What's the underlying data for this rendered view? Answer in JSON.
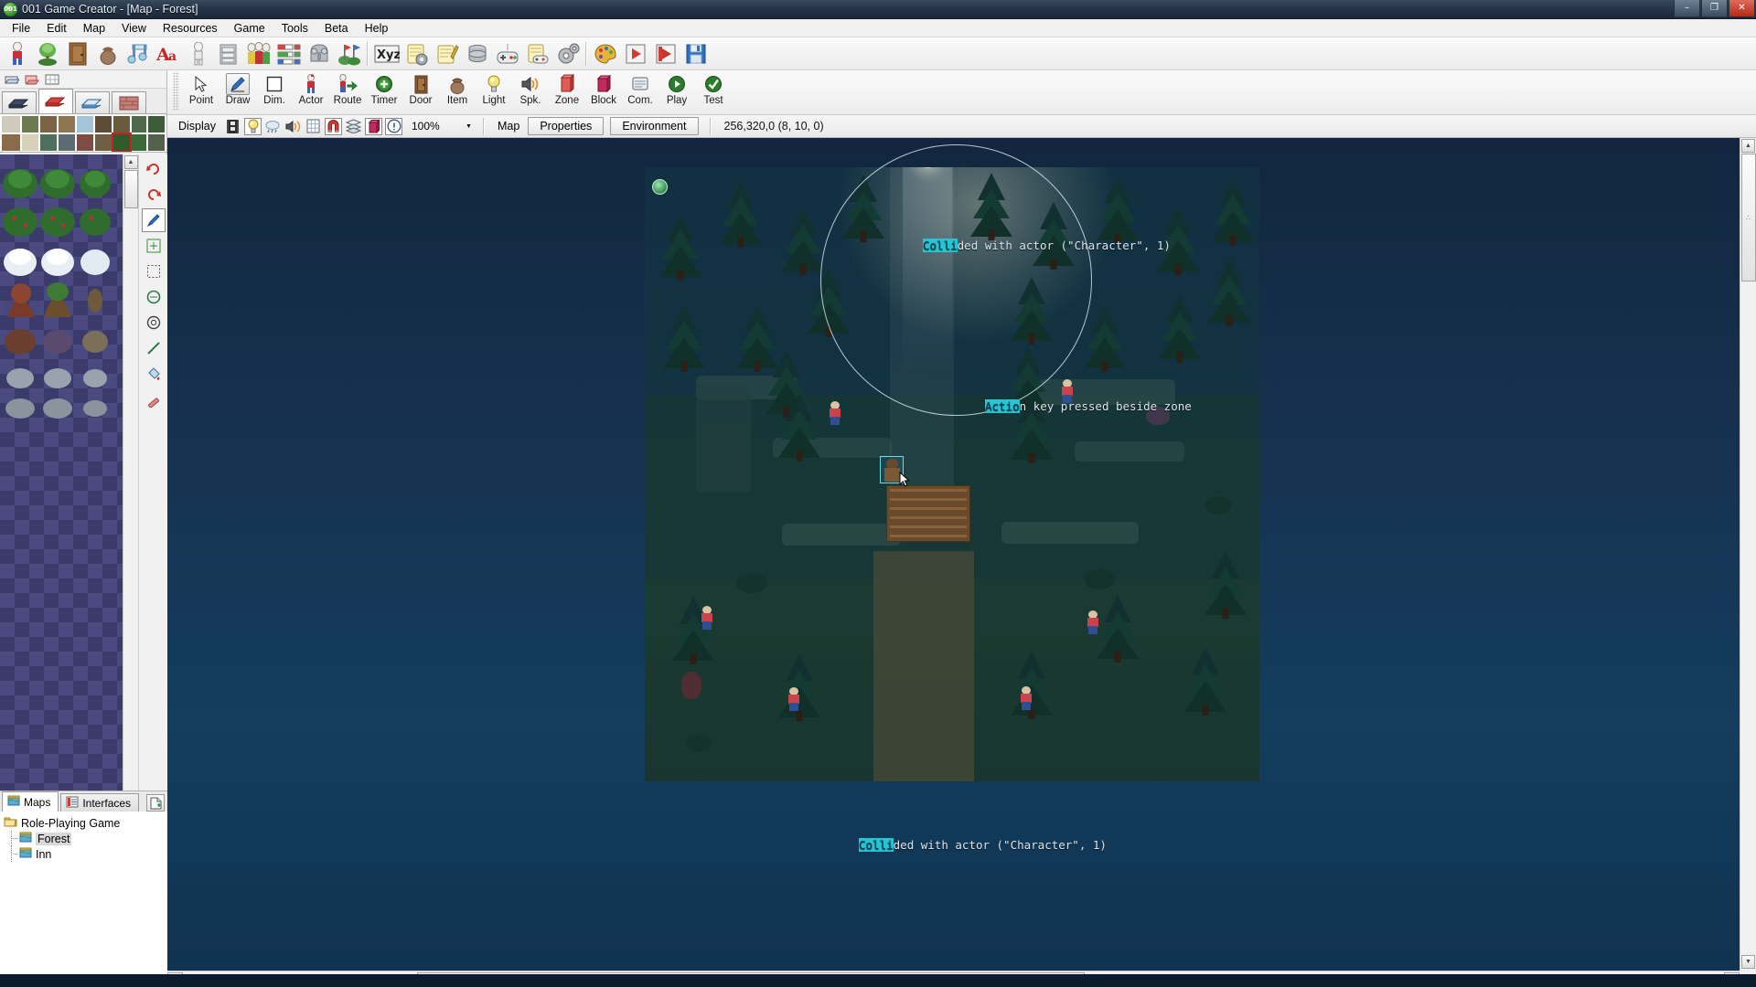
{
  "window": {
    "title": "001 Game Creator - [Map - Forest]",
    "app_icon": "001",
    "minimize": "–",
    "maximize": "❐",
    "close": "✕"
  },
  "menu": {
    "items": [
      {
        "label": "File"
      },
      {
        "label": "Edit"
      },
      {
        "label": "Map"
      },
      {
        "label": "View"
      },
      {
        "label": "Resources"
      },
      {
        "label": "Game"
      },
      {
        "label": "Tools"
      },
      {
        "label": "Beta"
      },
      {
        "label": "Help"
      }
    ]
  },
  "main_toolbar": {
    "buttons": [
      {
        "name": "actor-icon",
        "title": "Actors"
      },
      {
        "name": "tree-icon",
        "title": "Plants"
      },
      {
        "name": "door-icon",
        "title": "Doors"
      },
      {
        "name": "item-icon",
        "title": "Items"
      },
      {
        "name": "music-icon",
        "title": "Music"
      },
      {
        "name": "font-icon",
        "title": "Fonts"
      },
      {
        "name": "skeleton-icon",
        "title": "Animations"
      },
      {
        "name": "cabinet-icon",
        "title": "Database"
      },
      {
        "name": "party-icon",
        "title": "Party"
      },
      {
        "name": "bars-icon",
        "title": "Attributes"
      },
      {
        "name": "armor-icon",
        "title": "Armor"
      },
      {
        "name": "flags-icon",
        "title": "Teams"
      },
      {
        "name": "xyz-icon",
        "title": "Variables"
      },
      {
        "name": "script-gear-icon",
        "title": "Scripts"
      },
      {
        "name": "script-edit-icon",
        "title": "Edit script"
      },
      {
        "name": "database-icon",
        "title": "Data"
      },
      {
        "name": "gamepad-icon",
        "title": "Controls"
      },
      {
        "name": "script-gamepad-icon",
        "title": "Input scripts"
      },
      {
        "name": "gears-icon",
        "title": "Settings"
      },
      {
        "name": "palette-icon",
        "title": "Palette"
      },
      {
        "name": "play-icon",
        "title": "Play"
      },
      {
        "name": "record-icon",
        "title": "Record"
      },
      {
        "name": "save-icon",
        "title": "Save"
      }
    ]
  },
  "tools_toolbar": {
    "active": "Draw",
    "tools": [
      {
        "label": "Point",
        "icon": "cursor-icon"
      },
      {
        "label": "Draw",
        "icon": "pencil-icon"
      },
      {
        "label": "Dim.",
        "icon": "square-icon"
      },
      {
        "label": "Actor",
        "icon": "actor-icon"
      },
      {
        "label": "Route",
        "icon": "route-icon"
      },
      {
        "label": "Timer",
        "icon": "timer-icon"
      },
      {
        "label": "Door",
        "icon": "door-icon"
      },
      {
        "label": "Item",
        "icon": "item-bag-icon"
      },
      {
        "label": "Light",
        "icon": "lightbulb-icon"
      },
      {
        "label": "Spk.",
        "icon": "speaker-icon"
      },
      {
        "label": "Zone",
        "icon": "zone-icon"
      },
      {
        "label": "Block",
        "icon": "block-icon"
      },
      {
        "label": "Com.",
        "icon": "command-icon"
      },
      {
        "label": "Play",
        "icon": "play-icon"
      },
      {
        "label": "Test",
        "icon": "test-icon"
      }
    ]
  },
  "display_bar": {
    "label": "Display",
    "icons": [
      {
        "name": "film-icon",
        "active": false
      },
      {
        "name": "lightbulb-icon",
        "active": true
      },
      {
        "name": "weather-icon",
        "active": false
      },
      {
        "name": "sound-icon",
        "active": false
      },
      {
        "name": "grid-icon",
        "active": false
      },
      {
        "name": "magnet-icon",
        "active": true
      },
      {
        "name": "layers-icon",
        "active": false
      },
      {
        "name": "block-icon",
        "active": true
      },
      {
        "name": "info-icon",
        "active": true
      }
    ],
    "zoom": "100%",
    "dropdown_arrow": "▼",
    "map_label": "Map",
    "tabs": [
      {
        "label": "Properties"
      },
      {
        "label": "Environment"
      }
    ],
    "coordinates": "256,320,0 (8, 10, 0)"
  },
  "left_panel": {
    "mini_toolbar": [
      {
        "name": "tileset-open-icon"
      },
      {
        "name": "tileset-import-icon"
      },
      {
        "name": "tileset-grid-icon"
      }
    ],
    "tileset_tabs": [
      {
        "name": "tab-tileset-a",
        "active": false
      },
      {
        "name": "tab-tileset-b",
        "active": true
      },
      {
        "name": "tab-tileset-c",
        "active": false
      },
      {
        "name": "tab-tileset-wall",
        "active": false
      }
    ],
    "vertical_tools": [
      {
        "name": "undo-icon",
        "active": false
      },
      {
        "name": "redo-icon",
        "active": false
      },
      {
        "name": "pencil-tool-icon",
        "active": true
      },
      {
        "name": "fill-tool-icon",
        "active": false
      },
      {
        "name": "rect-select-icon",
        "active": false
      },
      {
        "name": "ellipse-tool-icon",
        "active": false
      },
      {
        "name": "circle-tool-icon",
        "active": false
      },
      {
        "name": "line-tool-icon",
        "active": false
      },
      {
        "name": "bucket-tool-icon",
        "active": false
      },
      {
        "name": "eraser-tool-icon",
        "active": false
      }
    ]
  },
  "project_tree": {
    "tabs": [
      {
        "label": "Maps",
        "icon": "map-icon",
        "active": true
      },
      {
        "label": "Interfaces",
        "icon": "interfaces-icon",
        "active": false
      }
    ],
    "new_button": "new-document-icon",
    "root": {
      "label": "Role-Playing Game",
      "icon": "folder-icon"
    },
    "children": [
      {
        "label": "Forest",
        "icon": "map-icon",
        "selected": true
      },
      {
        "label": "Inn",
        "icon": "map-icon",
        "selected": false
      }
    ]
  },
  "map_canvas": {
    "overlay_texts": [
      {
        "id": "collided-top",
        "highlight": "Colli",
        "rest": "ded with actor (\"Character\", 1)"
      },
      {
        "id": "action-zone",
        "highlight": "Actio",
        "rest": "n key pressed beside zone"
      },
      {
        "id": "collided-bottom",
        "highlight": "Colli",
        "rest": "ded with actor (\"Character\", 1)"
      }
    ],
    "scroll": {
      "left_arrow": "◄",
      "right_arrow": "►",
      "up_arrow": "▲",
      "down_arrow": "▼",
      "grip": "∴"
    }
  }
}
